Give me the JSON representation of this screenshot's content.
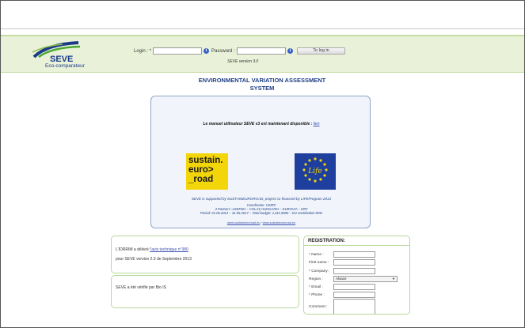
{
  "header": {
    "logo_text": "SEVE",
    "logo_subtitle": "Eco-comparateur",
    "login_label": "Login : *",
    "password_label": "Password : *",
    "login_button": "To log in",
    "version": "SEVE version 3.0"
  },
  "title": {
    "line1": "ENVIRONMENTAL VARIATION ASSESSMENT",
    "line2": "SYSTEM"
  },
  "main_box": {
    "manual_text": "Le manuel utilisateur SEVE v3 est maintenant disponible :",
    "manual_link": "lien",
    "sustain_logo_lines": [
      "sustain.",
      "euro>",
      "_road"
    ],
    "eu_logo_text": "Life",
    "supported_text": "SEVE is supported by SUSTAINEUROROAD, project co-financed by LIFEProgram 2013",
    "partners_line1": "Coordinator: USIRF",
    "partners_line2": "4 Partners :ASEFMA – COLAS HUNGARIA – EUROVIA – ERF",
    "partners_line3": "Period: 01.06.2014 – 31.05.2017 – Total budget: 1,311,960€ – EU contribution:50%",
    "link1": "www.sustaineuroroad.eu",
    "link_sep": " / ",
    "link2": "www.sustaineuroroad.eu"
  },
  "info1": {
    "text_before": "L'IDRRIM a délivré",
    "link": "l'avis technique n°380",
    "text_after": "pour SEVE version 2.0 de Septembre 2013"
  },
  "info2": {
    "text": "SEVE a été vérifié par Bio IS"
  },
  "registration": {
    "title": "REGISTRATION:",
    "name_label": "* Name :",
    "first_name_label": "First name :",
    "company_label": "* Company :",
    "region_label": "Region :",
    "region_value": "Alsace",
    "email_label": "* Email :",
    "phone_label": "* Phone :",
    "comment_label": "Comment :"
  },
  "colors": {
    "header_bg": "#e9f2d9",
    "title_blue": "#1f3f86",
    "accent_green": "#b8d99a"
  }
}
